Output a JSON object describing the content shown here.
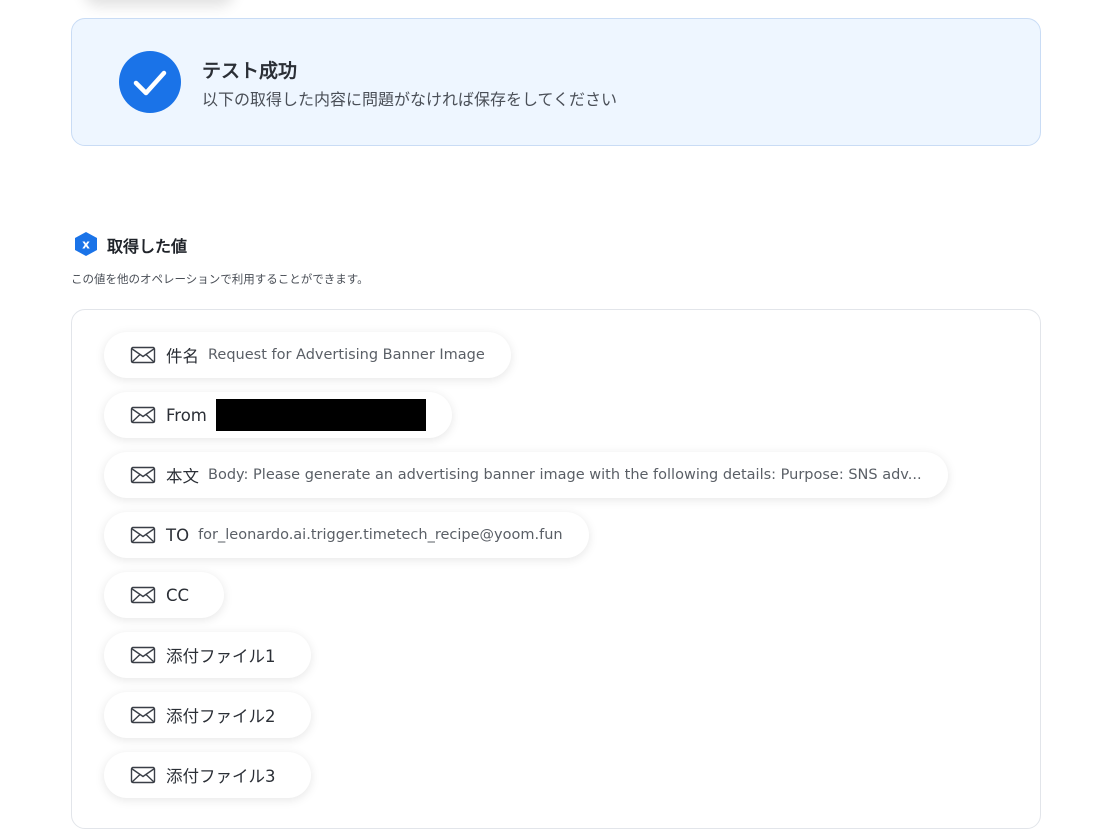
{
  "success": {
    "title": "テスト成功",
    "message": "以下の取得した内容に問題がなければ保存をしてください",
    "accent_color": "#1a73e8",
    "background_color": "#eef6ff",
    "icon": "check-circle-icon"
  },
  "values_section": {
    "heading": "取得した値",
    "heading_icon": "variable-x-icon",
    "description": "この値を他のオペレーションで利用することができます。"
  },
  "fields": [
    {
      "name": "件名",
      "value": "Request for Advertising Banner Image"
    },
    {
      "name": "From",
      "value": "",
      "redacted": true
    },
    {
      "name": "本文",
      "value": "Body: Please generate an advertising banner image with the following details: Purpose: SNS adv..."
    },
    {
      "name": "TO",
      "value": "for_leonardo.ai.trigger.timetech_recipe@yoom.fun"
    },
    {
      "name": "CC",
      "value": ""
    },
    {
      "name": "添付ファイル1",
      "value": ""
    },
    {
      "name": "添付ファイル2",
      "value": ""
    },
    {
      "name": "添付ファイル3",
      "value": ""
    }
  ]
}
